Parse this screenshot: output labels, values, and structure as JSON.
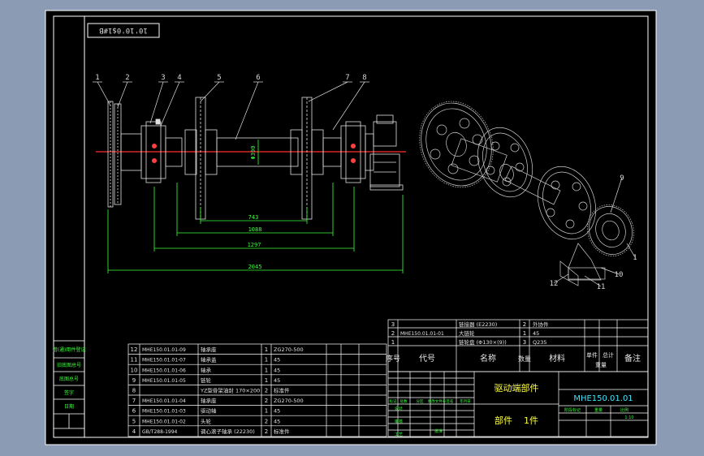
{
  "drawing": {
    "stamp_box": "10'10'0$1#B",
    "title": "驱动端部件",
    "drawing_no": "MHE150.01.01",
    "part_label": "部件",
    "part_count": "1件"
  },
  "leaders": [
    "1",
    "2",
    "3",
    "4",
    "5",
    "6",
    "7",
    "8"
  ],
  "iso_leaders": [
    "9",
    "1",
    "10",
    "11",
    "12"
  ],
  "dimensions": {
    "vertical": "Φ390",
    "d1": "743",
    "d2": "1088",
    "d3": "1297",
    "d4": "2045"
  },
  "bom_upper": [
    {
      "no": "3",
      "code": "",
      "name": "链接器 (E2230)",
      "qty": "2",
      "material": "外协件"
    },
    {
      "no": "2",
      "code": "MHE150.01.01-01",
      "name": "大链轮",
      "qty": "1",
      "material": "45"
    },
    {
      "no": "1",
      "code": "",
      "name": "链轮盘 (Φ130×(9))",
      "qty": "3",
      "material": "Q235"
    }
  ],
  "bom_header": {
    "no": "序号",
    "code": "代号",
    "name": "名称",
    "qty": "数量",
    "material": "材料",
    "unit_weight": "单件",
    "total_weight": "总计",
    "weight": "重量",
    "remark": "备注"
  },
  "bom_lower": [
    {
      "no": "12",
      "code": "MHE150.01.01-09",
      "name": "轴承座",
      "qty": "1",
      "material": "ZG270-500"
    },
    {
      "no": "11",
      "code": "MHE150.01.01-07",
      "name": "轴承盖",
      "qty": "1",
      "material": "45"
    },
    {
      "no": "10",
      "code": "MHE150.01.01-06",
      "name": "轴承",
      "qty": "1",
      "material": "45"
    },
    {
      "no": "9",
      "code": "MHE150.01.01-05",
      "name": "链轮",
      "qty": "1",
      "material": "45"
    },
    {
      "no": "8",
      "code": "",
      "name": "YZ型骨架油封 170×200",
      "qty": "2",
      "material": "标准件"
    },
    {
      "no": "7",
      "code": "MHE150.01.01-04",
      "name": "轴承座",
      "qty": "2",
      "material": "ZG270-500"
    },
    {
      "no": "6",
      "code": "MHE150.01.01-03",
      "name": "驱动轴",
      "qty": "1",
      "material": "45"
    },
    {
      "no": "5",
      "code": "MHE150.01.01-02",
      "name": "头轮",
      "qty": "2",
      "material": "45"
    },
    {
      "no": "4",
      "code": "GB/T288-1994",
      "name": "调心滚子轴承 (22230)",
      "qty": "2",
      "material": "标准件"
    }
  ],
  "side_labels": [
    "借(通)用件登记",
    "旧底图总号",
    "底图总号",
    "签字",
    "日期"
  ],
  "title_block": {
    "rows_left": [
      "标记",
      "处数",
      "分区",
      "更改文件号",
      "签名",
      "年月日"
    ],
    "roles": [
      "设计",
      "审核",
      "工艺"
    ],
    "sub": [
      "阶段标记",
      "重量",
      "比例"
    ],
    "scale": "1:10",
    "approve": "批准"
  }
}
